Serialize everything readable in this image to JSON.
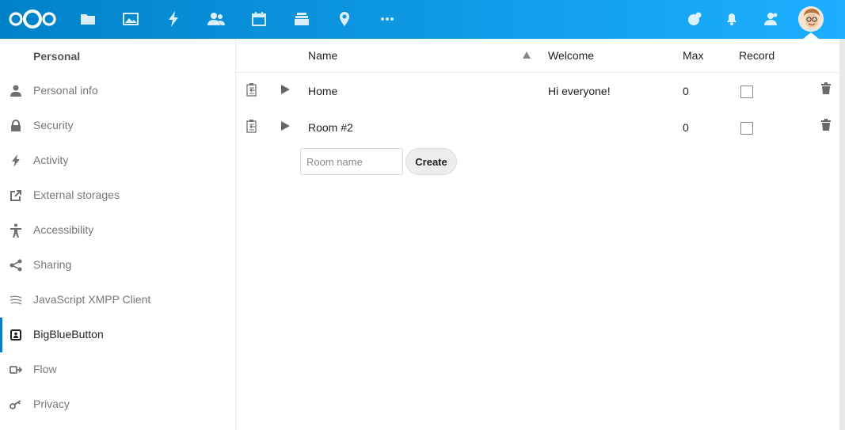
{
  "header": {
    "logo_name": "nextcloud-logo",
    "apps": [
      {
        "name": "files-icon"
      },
      {
        "name": "photos-icon"
      },
      {
        "name": "activity-icon"
      },
      {
        "name": "contacts-icon"
      },
      {
        "name": "calendar-icon"
      },
      {
        "name": "deck-icon"
      },
      {
        "name": "maps-icon"
      },
      {
        "name": "more-apps-icon"
      }
    ],
    "right_icons": [
      {
        "name": "talk-icon"
      },
      {
        "name": "notifications-icon"
      },
      {
        "name": "contacts-menu-icon"
      }
    ],
    "accent_colors": [
      "#0082c9",
      "#1cafff"
    ]
  },
  "sidebar": {
    "heading": "Personal",
    "items": [
      {
        "label": "Personal info",
        "icon": "user-icon"
      },
      {
        "label": "Security",
        "icon": "lock-icon"
      },
      {
        "label": "Activity",
        "icon": "lightning-icon"
      },
      {
        "label": "External storages",
        "icon": "external-link-icon"
      },
      {
        "label": "Accessibility",
        "icon": "accessibility-icon"
      },
      {
        "label": "Sharing",
        "icon": "share-icon"
      },
      {
        "label": "JavaScript XMPP Client",
        "icon": "xmpp-icon"
      },
      {
        "label": "BigBlueButton",
        "icon": "bigbluebutton-icon",
        "active": true
      },
      {
        "label": "Flow",
        "icon": "flow-icon"
      },
      {
        "label": "Privacy",
        "icon": "key-icon"
      }
    ]
  },
  "table": {
    "columns": {
      "name": "Name",
      "welcome": "Welcome",
      "max": "Max",
      "record": "Record"
    },
    "sort": "ascending",
    "rows": [
      {
        "name": "Home",
        "welcome": "Hi everyone!",
        "max": "0",
        "record": false
      },
      {
        "name": "Room #2",
        "welcome": "",
        "max": "0",
        "record": false
      }
    ]
  },
  "create_form": {
    "placeholder": "Room name",
    "value": "",
    "button_label": "Create"
  }
}
